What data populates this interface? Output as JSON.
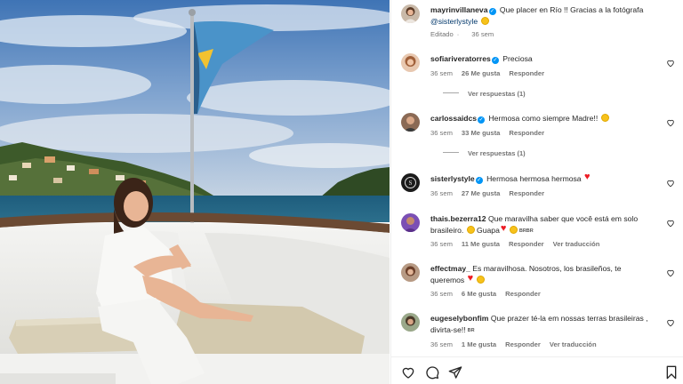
{
  "post": {
    "author": "mayrinvillaneva",
    "caption": "Que placer en Río !! Gracias a la fotógrafa",
    "mention": "@sisterlystyle",
    "edited": "Editado",
    "age": "36 sem"
  },
  "comments": [
    {
      "user": "sofiariveratorres",
      "verified": true,
      "text": "Preciosa",
      "text2": "",
      "age": "36 sem",
      "likes": "26 Me gusta",
      "reply": "Responder",
      "translate": "",
      "emojis": [],
      "view_replies": "Ver respuestas (1)"
    },
    {
      "user": "carlossaidcs",
      "verified": true,
      "text": "Hermosa como siempre Madre!!",
      "text2": "",
      "age": "36 sem",
      "likes": "33 Me gusta",
      "reply": "Responder",
      "translate": "",
      "emojis": [
        "smiling-face-with-heart-eyes"
      ],
      "view_replies": "Ver respuestas (1)"
    },
    {
      "user": "sisterlystyle",
      "verified": true,
      "text": "Hermosa hermosa hermosa",
      "text2": "",
      "age": "36 sem",
      "likes": "27 Me gusta",
      "reply": "Responder",
      "translate": "",
      "emojis": [
        "red-heart"
      ],
      "view_replies": ""
    },
    {
      "user": "thais.bezerra12",
      "verified": false,
      "text": "Que maravilha saber que você está em solo",
      "text2": "brasileiro.",
      "text3": "Guapa",
      "flag": "BRBR",
      "age": "36 sem",
      "likes": "11 Me gusta",
      "reply": "Responder",
      "translate": "Ver traducción",
      "emojis": [
        "grinning-face",
        "red-heart",
        "smiling-face-with-heart-eyes"
      ],
      "view_replies": ""
    },
    {
      "user": "effectmay_",
      "verified": false,
      "text": "Es maravilhosa. Nosotros, los brasileños, te",
      "text2": "queremos",
      "age": "36 sem",
      "likes": "6 Me gusta",
      "reply": "Responder",
      "translate": "",
      "emojis": [
        "red-heart",
        "smiling-face-with-heart-eyes"
      ],
      "view_replies": ""
    },
    {
      "user": "eugeselybonfim",
      "verified": false,
      "text": "Que prazer té-la em nossas terras brasileiras ,",
      "text2": "divirta-se!!",
      "flag": "BR",
      "age": "36 sem",
      "likes": "1 Me gusta",
      "reply": "Responder",
      "translate": "Ver traducción",
      "emojis": [],
      "view_replies": ""
    }
  ],
  "icons": {
    "like": "heart-outline-icon",
    "comment": "comment-bubble-icon",
    "share": "paper-plane-icon",
    "save": "bookmark-icon"
  },
  "colors": {
    "link": "#00376b",
    "verified": "#0095f6",
    "muted": "#737373",
    "heart": "#ed1c24"
  }
}
